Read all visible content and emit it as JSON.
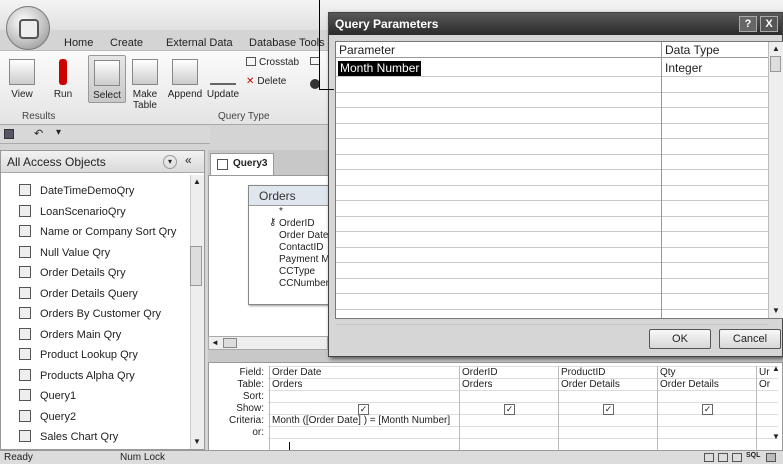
{
  "ribbon": {
    "tabs": [
      "Home",
      "Create",
      "External Data",
      "Database Tools"
    ],
    "buttons": {
      "view": "View",
      "run": "Run",
      "select": "Select",
      "make_table_1": "Make",
      "make_table_2": "Table",
      "append": "Append",
      "update": "Update",
      "crosstab": "Crosstab",
      "delete": "Delete"
    },
    "groups": {
      "results": "Results",
      "query_type": "Query Type"
    }
  },
  "nav": {
    "title": "All Access Objects",
    "items": [
      "DateTimeDemoQry",
      "LoanScenarioQry",
      "Name or Company Sort Qry",
      "Null Value Qry",
      "Order Details Qry",
      "Order Details Query",
      "Orders By Customer Qry",
      "Orders Main Qry",
      "Product Lookup Qry",
      "Products Alpha Qry",
      "Query1",
      "Query2",
      "Sales Chart Qry"
    ]
  },
  "query": {
    "tab": "Query3",
    "table": {
      "name": "Orders",
      "fields": [
        "*",
        "OrderID",
        "Order Date",
        "ContactID",
        "Payment M",
        "CCType",
        "CCNumber"
      ]
    }
  },
  "grid": {
    "row_labels": [
      "Field:",
      "Table:",
      "Sort:",
      "Show:",
      "Criteria:",
      "or:"
    ],
    "columns": [
      {
        "field": "Order Date",
        "table": "Orders",
        "show": "✓",
        "criteria": "Month ([Order Date] ) = [Month Number]"
      },
      {
        "field": "OrderID",
        "table": "Orders",
        "show": "✓",
        "criteria": ""
      },
      {
        "field": "ProductID",
        "table": "Order Details",
        "show": "✓",
        "criteria": ""
      },
      {
        "field": "Qty",
        "table": "Order Details",
        "show": "✓",
        "criteria": ""
      },
      {
        "field": "Ur",
        "table": "Or",
        "show": "",
        "criteria": ""
      }
    ]
  },
  "dialog": {
    "title": "Query Parameters",
    "help": "?",
    "close": "X",
    "col_parameter": "Parameter",
    "col_datatype": "Data Type",
    "param_name": "Month Number",
    "param_type": "Integer",
    "ok": "OK",
    "cancel": "Cancel"
  },
  "status": {
    "left": "Ready",
    "num_lock": "Num Lock",
    "sql": "SQL"
  }
}
